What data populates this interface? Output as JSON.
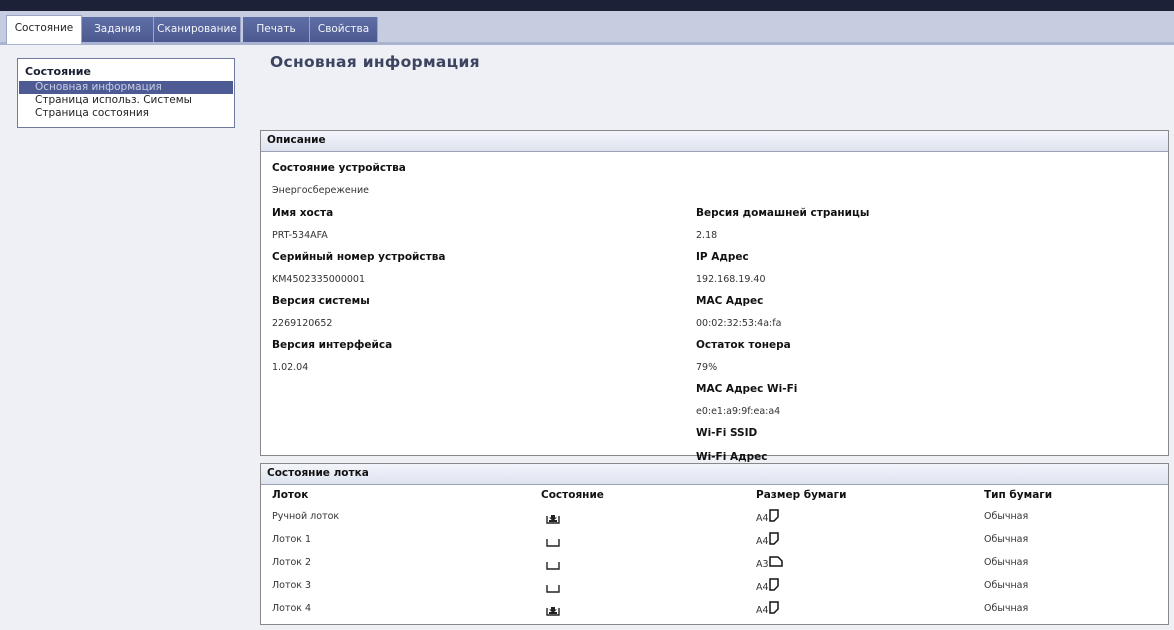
{
  "tabs": [
    {
      "label": "Состояние"
    },
    {
      "label": "Задания"
    },
    {
      "label": "Сканирование"
    },
    {
      "label": "Печать"
    },
    {
      "label": "Свойства"
    }
  ],
  "sidebar": {
    "title": "Состояние",
    "items": [
      {
        "label": "Основная информация"
      },
      {
        "label": "Страница использ. Системы"
      },
      {
        "label": "Страница состояния"
      }
    ]
  },
  "page_title": "Основная информация",
  "description": {
    "header": "Описание",
    "device_state_label": "Состояние устройства",
    "device_state_value": "Энергосбережение",
    "hostname_label": "Имя хоста",
    "hostname_value": "PRT-534AFA",
    "serial_label": "Серийный номер устройства",
    "serial_value": "KM4502335000001",
    "system_version_label": "Версия системы",
    "system_version_value": "2269120652",
    "interface_version_label": "Версия интерфейса",
    "interface_version_value": "1.02.04",
    "homepage_version_label": "Версия домашней страницы",
    "homepage_version_value": "2.18",
    "ip_label": "IP Адрес",
    "ip_value": "192.168.19.40",
    "mac_label": "MAC Адрес",
    "mac_value": "00:02:32:53:4a:fa",
    "toner_label": "Остаток тонера",
    "toner_value": "79%",
    "wifi_mac_label": "MAC Адрес Wi-Fi",
    "wifi_mac_value": "e0:e1:a9:9f:ea:a4",
    "wifi_ssid_label": "Wi-Fi SSID",
    "wifi_addr_label": "Wi-Fi Адрес"
  },
  "tray_status": {
    "header": "Состояние лотка",
    "columns": [
      "Лоток",
      "Состояние",
      "Размер бумаги",
      "Тип бумаги"
    ],
    "rows": [
      {
        "tray": "Ручной лоток",
        "state_icon": "tray-low-icon",
        "size": "A4",
        "orientation": "portrait",
        "type": "Обычная"
      },
      {
        "tray": "Лоток 1",
        "state_icon": "tray-empty-icon",
        "size": "A4",
        "orientation": "portrait",
        "type": "Обычная"
      },
      {
        "tray": "Лоток 2",
        "state_icon": "tray-empty-icon",
        "size": "A3",
        "orientation": "landscape",
        "type": "Обычная"
      },
      {
        "tray": "Лоток 3",
        "state_icon": "tray-empty-icon",
        "size": "A4",
        "orientation": "portrait",
        "type": "Обычная"
      },
      {
        "tray": "Лоток 4",
        "state_icon": "tray-low-icon",
        "size": "A4",
        "orientation": "portrait",
        "type": "Обычная"
      }
    ]
  }
}
